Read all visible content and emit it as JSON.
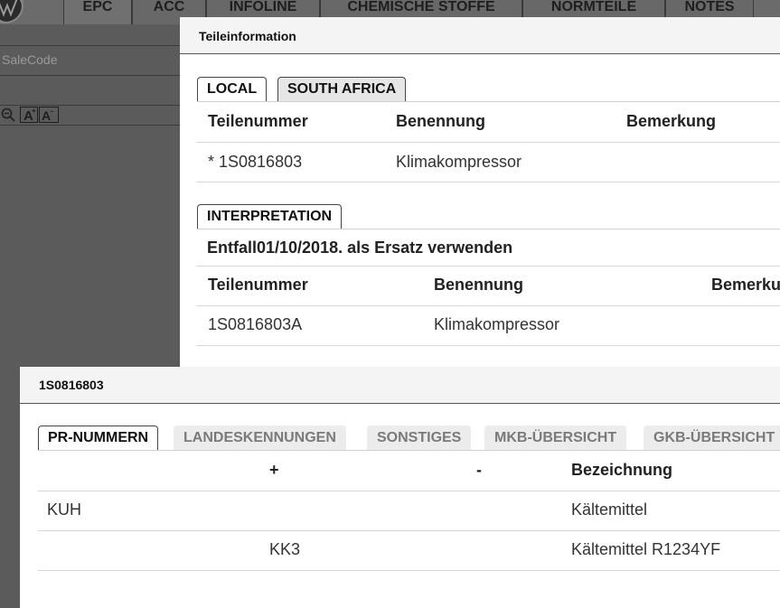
{
  "app": {
    "tabs": [
      {
        "label": "EPC"
      },
      {
        "label": "ACC"
      },
      {
        "label": "INFOLINE"
      },
      {
        "label": "CHEMISCHE STOFFE"
      },
      {
        "label": "NORMTEILE"
      },
      {
        "label": "NOTES"
      }
    ],
    "salecode_placeholder": "SaleCode",
    "zoom_controls": [
      "zoom-out-icon",
      "font-increase-icon",
      "font-decrease-icon"
    ]
  },
  "teileinfo": {
    "title": "Teileinformation",
    "region_tabs": [
      {
        "label": "LOCAL"
      },
      {
        "label": "SOUTH AFRICA"
      }
    ],
    "columns": [
      "Teilenummer",
      "Benennung",
      "Bemerkung"
    ],
    "rows": [
      {
        "teilenummer": "* 1S0816803",
        "benennung": "Klimakompressor",
        "bemerkung": ""
      }
    ],
    "interpretation": {
      "tab_label": "INTERPRETATION",
      "note": "Entfall01/10/2018. als Ersatz verwenden",
      "columns": [
        "Teilenummer",
        "Benennung",
        "Bemerku"
      ],
      "rows": [
        {
          "teilenummer": "1S0816803A",
          "benennung": "Klimakompressor",
          "bemerkung": ""
        }
      ]
    }
  },
  "part_detail": {
    "title": "1S0816803",
    "tabs": [
      {
        "label": "PR-NUMMERN"
      },
      {
        "label": "LANDESKENNUNGEN"
      },
      {
        "label": "SONSTIGES"
      },
      {
        "label": "MKB-ÜBERSICHT"
      },
      {
        "label": "GKB-ÜBERSICHT"
      }
    ],
    "columns": [
      "",
      "+",
      "-",
      "Bezeichnung"
    ],
    "rows": [
      {
        "code": "KUH",
        "plus": "",
        "minus": "",
        "bezeichnung": "Kältemittel"
      },
      {
        "code": "",
        "plus": "KK3",
        "minus": "",
        "bezeichnung": "Kältemittel R1234YF"
      }
    ]
  }
}
